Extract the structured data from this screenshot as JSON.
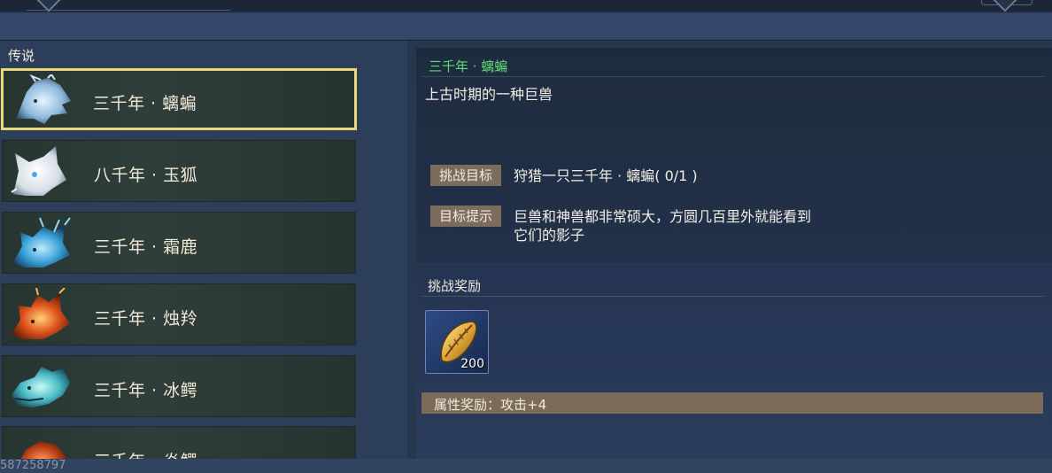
{
  "section": {
    "title": "传说"
  },
  "creatures": [
    {
      "label": "三千年 · 螭蝙",
      "icon": "frost-dragon-portrait-icon",
      "selected": true
    },
    {
      "label": "八千年 · 玉狐",
      "icon": "white-fox-portrait-icon",
      "selected": false
    },
    {
      "label": "三千年 · 霜鹿",
      "icon": "ice-deer-portrait-icon",
      "selected": false
    },
    {
      "label": "三千年 · 烛羚",
      "icon": "fire-antelope-portrait-icon",
      "selected": false
    },
    {
      "label": "三千年 · 冰鳄",
      "icon": "ice-crocodile-portrait-icon",
      "selected": false
    },
    {
      "label": "三千年 · 炎鳄",
      "icon": "fire-crocodile-portrait-icon",
      "selected": false
    }
  ],
  "detail": {
    "title": "三千年 · 螭蝙",
    "description": "上古时期的一种巨兽",
    "challenge_tag": "挑战目标",
    "challenge_text": "狩猎一只三千年 · 螭蝙( 0/1 )",
    "hint_tag": "目标提示",
    "hint_text": "巨兽和神兽都非常硕大，方圆几百里外就能看到它们的影子"
  },
  "reward": {
    "title": "挑战奖励",
    "item_icon": "golden-seed-icon",
    "item_count": "200",
    "attribute": "属性奖励：攻击+4"
  },
  "watermark": "587258797",
  "colors": {
    "title_green": "#5fdc7a",
    "selected_border": "#e7d879",
    "tag_bg": "#7b6c5b"
  }
}
